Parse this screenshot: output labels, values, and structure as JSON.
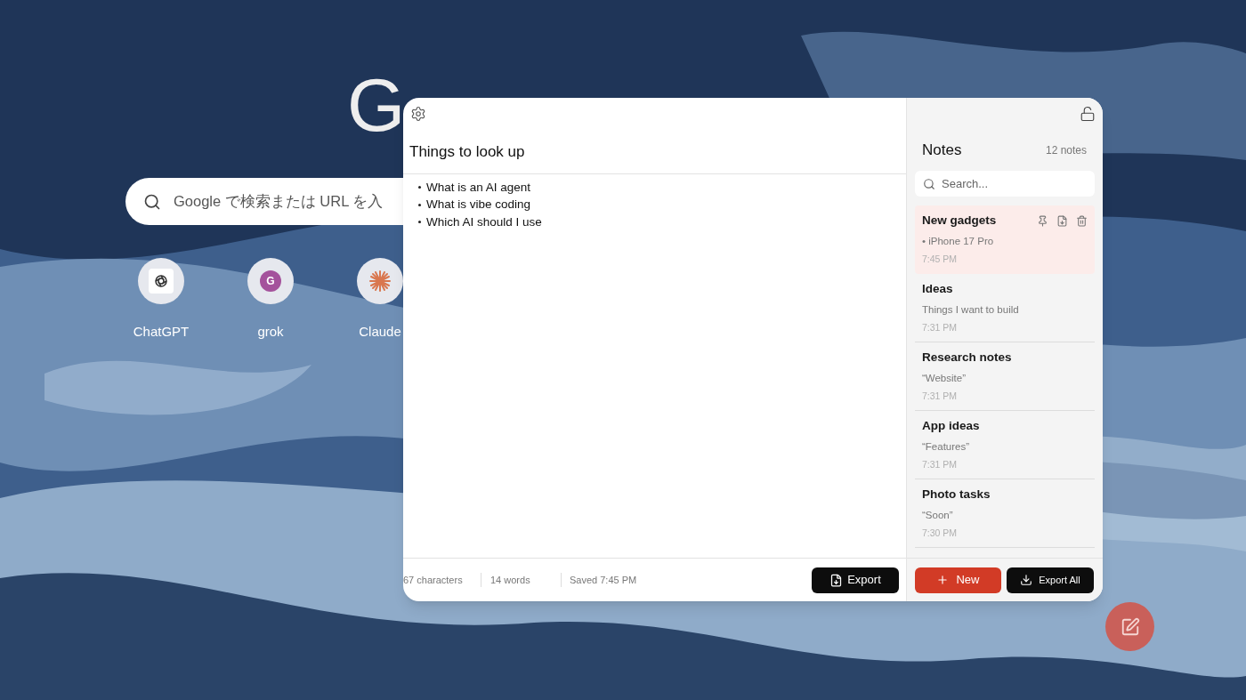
{
  "background": {
    "logo": "G",
    "search": {
      "placeholder": "Google で検索または URL を入"
    },
    "shortcuts": [
      {
        "label": "ChatGPT",
        "kind": "chatgpt"
      },
      {
        "label": "grok",
        "kind": "letter",
        "letter": "G"
      },
      {
        "label": "Claude",
        "kind": "claude"
      }
    ]
  },
  "editor": {
    "title": "Things to look up",
    "lines": [
      "What is an AI agent",
      "What is vibe coding",
      "Which AI should I use"
    ],
    "status": [
      "67 characters",
      "14 words",
      "Saved 7:45 PM"
    ],
    "export_button": "Export"
  },
  "sidebar": {
    "title": "Notes",
    "count": "12 notes",
    "search": {
      "placeholder": "Search..."
    },
    "notes": [
      {
        "title": "New gadgets",
        "preview": "• iPhone 17 Pro",
        "time": "7:45 PM",
        "selected": true
      },
      {
        "title": "Ideas",
        "preview": "Things I want to build",
        "time": "7:31 PM",
        "selected": false
      },
      {
        "title": "Research notes",
        "preview": "“Website”",
        "time": "7:31 PM",
        "selected": false
      },
      {
        "title": "App ideas",
        "preview": "“Features”",
        "time": "7:31 PM",
        "selected": false
      },
      {
        "title": "Photo tasks",
        "preview": "“Soon”",
        "time": "7:30 PM",
        "selected": false
      }
    ],
    "new_button": "New",
    "export_all_button": "Export All"
  }
}
